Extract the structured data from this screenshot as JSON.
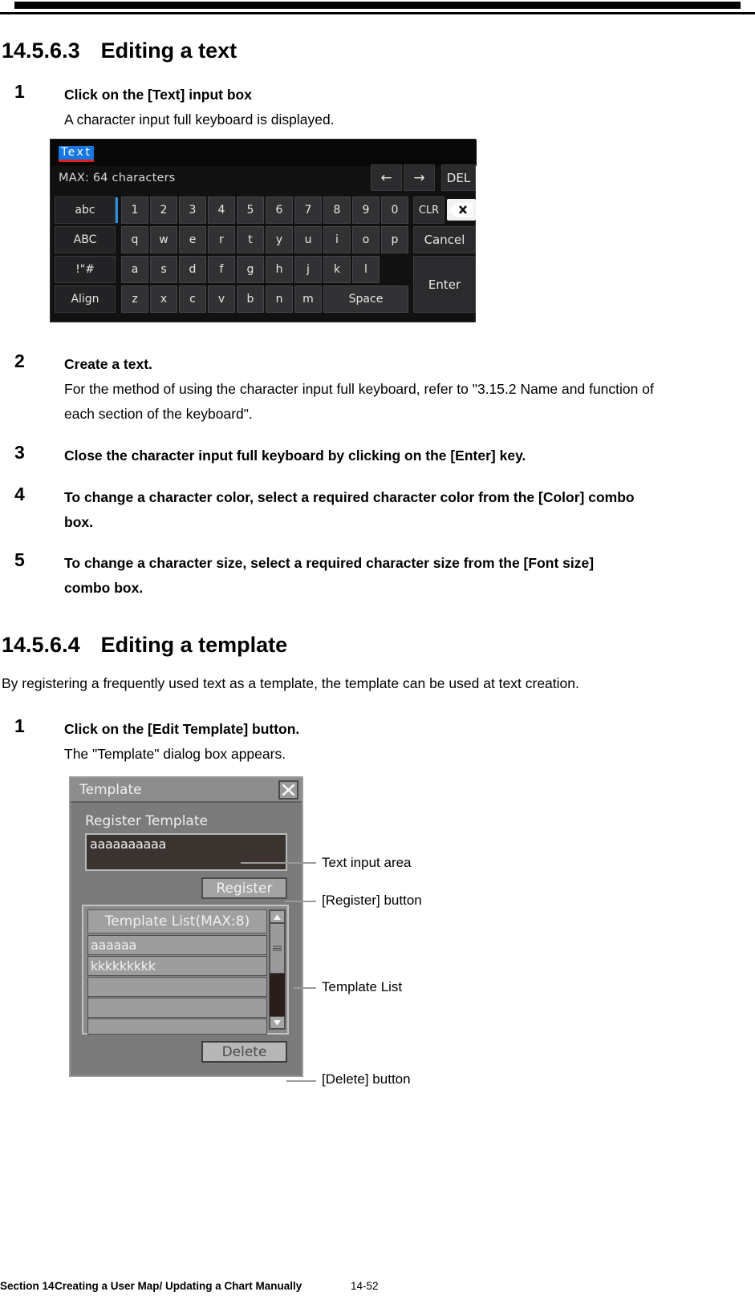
{
  "document": {
    "section_heading_3": {
      "number": "14.5.6.3",
      "title": "Editing a text"
    },
    "section_heading_4": {
      "number": "14.5.6.4",
      "title": "Editing a template"
    },
    "steps_text": [
      {
        "n": "1",
        "bold": "Click on the [Text] input box",
        "plain": "A character input full keyboard is displayed."
      },
      {
        "n": "2",
        "bold": "Create a text.",
        "plain_l1": "For the method of using the character input full keyboard, refer to \"3.15.2 Name and function of",
        "plain_l2": "each section of the keyboard\"."
      },
      {
        "n": "3",
        "bold": "Close the character input full keyboard by clicking on the [Enter] key."
      },
      {
        "n": "4",
        "bold_l1": "To change a character color, select a required character color from the [Color] combo",
        "bold_l2": "box."
      },
      {
        "n": "5",
        "bold_l1": "To change a character size, select a required character size from the [Font size]",
        "bold_l2": "combo box."
      }
    ],
    "template_intro": "By registering a frequently used text as a template, the template can be used at text creation.",
    "steps_template": [
      {
        "n": "1",
        "bold": "Click on the [Edit Template] button.",
        "plain": "The \"Template\" dialog box appears."
      }
    ],
    "footer": {
      "section": "Section 14",
      "title": "Creating a User Map/ Updating a Chart Manually",
      "page": "14-52"
    }
  },
  "keyboard": {
    "title_text": "Text",
    "max_label": "MAX: 64 characters",
    "nav_left": "←",
    "nav_right": "→",
    "del_label": "DEL",
    "mode_keys": [
      "abc",
      "ABC",
      "!\"#",
      "Align"
    ],
    "row_digits": [
      "1",
      "2",
      "3",
      "4",
      "5",
      "6",
      "7",
      "8",
      "9",
      "0"
    ],
    "row_q": [
      "q",
      "w",
      "e",
      "r",
      "t",
      "y",
      "u",
      "i",
      "o",
      "p"
    ],
    "row_a": [
      "a",
      "s",
      "d",
      "f",
      "g",
      "h",
      "j",
      "k",
      "l"
    ],
    "row_z": [
      "z",
      "x",
      "c",
      "v",
      "b",
      "n",
      "m"
    ],
    "space_label": "Space",
    "clr_label": "CLR",
    "backspace_label": "⌫",
    "cancel_label": "Cancel",
    "enter_label": "Enter",
    "colors": {
      "selection": "#1577e0",
      "underline": "#e02020",
      "cursor": "#2a8fe0"
    }
  },
  "template_dialog": {
    "title": "Template",
    "close_icon": "close-x-icon",
    "register_label": "Register Template",
    "text_value": "aaaaaaaaaa",
    "register_button": "Register",
    "list_header": "Template List(MAX:8)",
    "list_rows": [
      "aaaaaa",
      "kkkkkkkkk",
      "",
      "",
      ""
    ],
    "delete_button": "Delete",
    "scrollbar": {
      "up_icon": "triangle-up-icon",
      "down_icon": "triangle-down-icon",
      "grip_icon": "grip-lines-icon"
    }
  },
  "callouts": [
    {
      "label": "Text input area"
    },
    {
      "label": "[Register] button"
    },
    {
      "label": "Template List"
    },
    {
      "label": "[Delete] button"
    }
  ]
}
